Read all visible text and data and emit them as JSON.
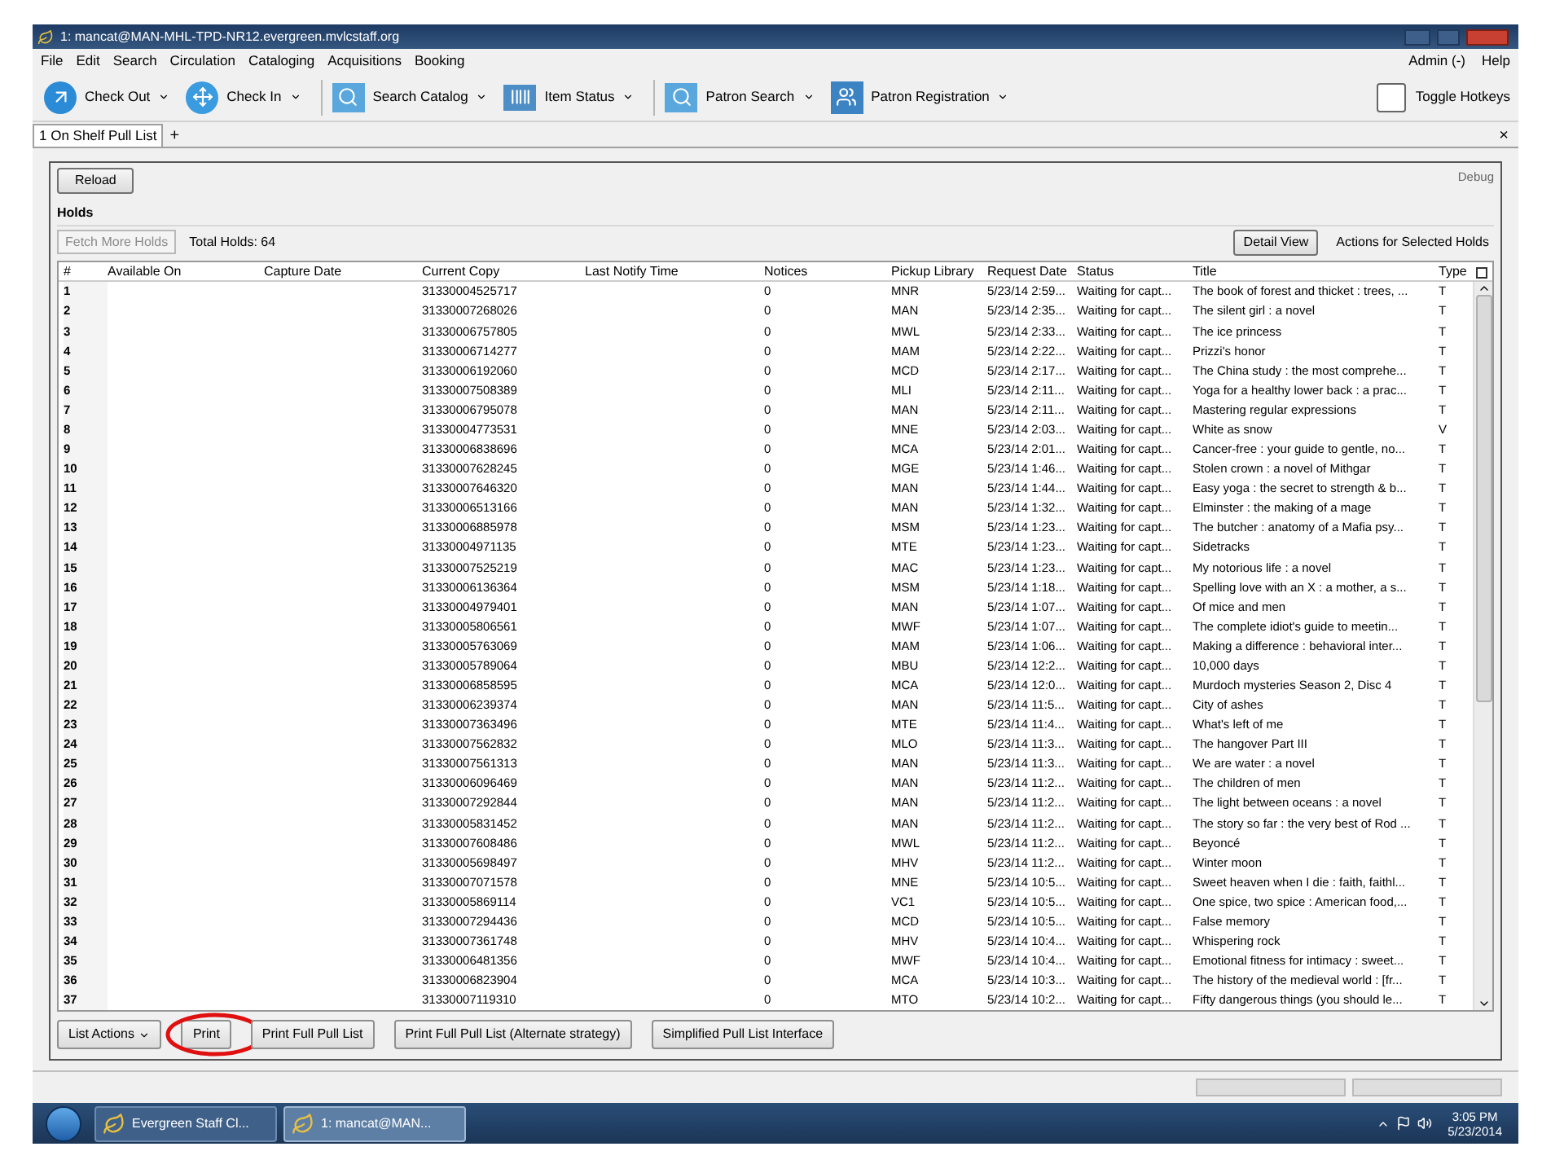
{
  "window": {
    "title": "1: mancat@MAN-MHL-TPD-NR12.evergreen.mvlcstaff.org"
  },
  "menu": [
    "File",
    "Edit",
    "Search",
    "Circulation",
    "Cataloging",
    "Acquisitions",
    "Booking"
  ],
  "menu_right": [
    "Admin (-)",
    "Help"
  ],
  "toolbar": [
    {
      "label": "Check Out",
      "kind": "checkout",
      "has_menu": true
    },
    {
      "label": "Check In",
      "kind": "checkin",
      "has_menu": true
    },
    {
      "label": "Search Catalog",
      "kind": "catalog",
      "has_menu": true
    },
    {
      "label": "Item Status",
      "kind": "item",
      "has_menu": true
    },
    {
      "label": "Patron Search",
      "kind": "patron",
      "has_menu": true
    },
    {
      "label": "Patron Registration",
      "kind": "register",
      "has_menu": true
    }
  ],
  "toggle_hotkeys": "Toggle Hotkeys",
  "tabs": [
    {
      "label": "1 On Shelf Pull List",
      "selected": true
    }
  ],
  "new_tab": "+",
  "close_tab": "×",
  "reload": "Reload",
  "debug": "Debug",
  "section": "Holds",
  "fetch_more": {
    "label": "Fetch More Holds",
    "disabled": true
  },
  "total": "Total Holds: 64",
  "detail_view": "Detail View",
  "actions_label": "Actions for Selected Holds",
  "columns": [
    "#",
    "Available On",
    "Capture Date",
    "Current Copy",
    "Last Notify Time",
    "Notices",
    "Pickup Library",
    "Request Date",
    "Status",
    "Title",
    "Type"
  ],
  "rows": [
    [
      "1",
      "31330004525717",
      "0",
      "MNR",
      "5/23/14 2:59...",
      "Waiting for capt...",
      "The book of forest and thicket : trees, ...",
      "T"
    ],
    [
      "2",
      "31330007268026",
      "0",
      "MAN",
      "5/23/14 2:35...",
      "Waiting for capt...",
      "The silent girl : a novel",
      "T"
    ],
    [
      "3",
      "31330006757805",
      "0",
      "MWL",
      "5/23/14 2:33...",
      "Waiting for capt...",
      "The ice princess",
      "T"
    ],
    [
      "4",
      "31330006714277",
      "0",
      "MAM",
      "5/23/14 2:22...",
      "Waiting for capt...",
      "Prizzi's honor",
      "T"
    ],
    [
      "5",
      "31330006192060",
      "0",
      "MCD",
      "5/23/14 2:17...",
      "Waiting for capt...",
      "The China study : the most comprehe...",
      "T"
    ],
    [
      "6",
      "31330007508389",
      "0",
      "MLI",
      "5/23/14 2:11...",
      "Waiting for capt...",
      "Yoga for a healthy lower back : a prac...",
      "T"
    ],
    [
      "7",
      "31330006795078",
      "0",
      "MAN",
      "5/23/14 2:11...",
      "Waiting for capt...",
      "Mastering regular expressions",
      "T"
    ],
    [
      "8",
      "31330004773531",
      "0",
      "MNE",
      "5/23/14 2:03...",
      "Waiting for capt...",
      "White as snow",
      "V"
    ],
    [
      "9",
      "31330006838696",
      "0",
      "MCA",
      "5/23/14 2:01...",
      "Waiting for capt...",
      "Cancer-free : your guide to gentle, no...",
      "T"
    ],
    [
      "10",
      "31330007628245",
      "0",
      "MGE",
      "5/23/14 1:46...",
      "Waiting for capt...",
      "Stolen crown : a novel of Mithgar",
      "T"
    ],
    [
      "11",
      "31330007646320",
      "0",
      "MAN",
      "5/23/14 1:44...",
      "Waiting for capt...",
      "Easy yoga : the secret to strength & b...",
      "T"
    ],
    [
      "12",
      "31330006513166",
      "0",
      "MAN",
      "5/23/14 1:32...",
      "Waiting for capt...",
      "Elminster : the making of a mage",
      "T"
    ],
    [
      "13",
      "31330006885978",
      "0",
      "MSM",
      "5/23/14 1:23...",
      "Waiting for capt...",
      "The butcher : anatomy of a Mafia psy...",
      "T"
    ],
    [
      "14",
      "31330004971135",
      "0",
      "MTE",
      "5/23/14 1:23...",
      "Waiting for capt...",
      "Sidetracks",
      "T"
    ],
    [
      "15",
      "31330007525219",
      "0",
      "MAC",
      "5/23/14 1:23...",
      "Waiting for capt...",
      "My notorious life : a novel",
      "T"
    ],
    [
      "16",
      "31330006136364",
      "0",
      "MSM",
      "5/23/14 1:18...",
      "Waiting for capt...",
      "Spelling love with an X : a mother, a s...",
      "T"
    ],
    [
      "17",
      "31330004979401",
      "0",
      "MAN",
      "5/23/14 1:07...",
      "Waiting for capt...",
      "Of mice and men",
      "T"
    ],
    [
      "18",
      "31330005806561",
      "0",
      "MWF",
      "5/23/14 1:07...",
      "Waiting for capt...",
      "The complete idiot's guide to meetin...",
      "T"
    ],
    [
      "19",
      "31330005763069",
      "0",
      "MAM",
      "5/23/14 1:06...",
      "Waiting for capt...",
      "Making a difference : behavioral inter...",
      "T"
    ],
    [
      "20",
      "31330005789064",
      "0",
      "MBU",
      "5/23/14 12:2...",
      "Waiting for capt...",
      "10,000 days",
      "T"
    ],
    [
      "21",
      "31330006858595",
      "0",
      "MCA",
      "5/23/14 12:0...",
      "Waiting for capt...",
      "Murdoch mysteries Season 2, Disc 4",
      "T"
    ],
    [
      "22",
      "31330006239374",
      "0",
      "MAN",
      "5/23/14 11:5...",
      "Waiting for capt...",
      "City of ashes",
      "T"
    ],
    [
      "23",
      "31330007363496",
      "0",
      "MTE",
      "5/23/14 11:4...",
      "Waiting for capt...",
      "What's left of me",
      "T"
    ],
    [
      "24",
      "31330007562832",
      "0",
      "MLO",
      "5/23/14 11:3...",
      "Waiting for capt...",
      "The hangover Part III",
      "T"
    ],
    [
      "25",
      "31330007561313",
      "0",
      "MAN",
      "5/23/14 11:3...",
      "Waiting for capt...",
      "We are water : a novel",
      "T"
    ],
    [
      "26",
      "31330006096469",
      "0",
      "MAN",
      "5/23/14 11:2...",
      "Waiting for capt...",
      "The children of men",
      "T"
    ],
    [
      "27",
      "31330007292844",
      "0",
      "MAN",
      "5/23/14 11:2...",
      "Waiting for capt...",
      "The light between oceans : a novel",
      "T"
    ],
    [
      "28",
      "31330005831452",
      "0",
      "MAN",
      "5/23/14 11:2...",
      "Waiting for capt...",
      "The story so far : the very best of Rod ...",
      "T"
    ],
    [
      "29",
      "31330007608486",
      "0",
      "MWL",
      "5/23/14 11:2...",
      "Waiting for capt...",
      "Beyoncé",
      "T"
    ],
    [
      "30",
      "31330005698497",
      "0",
      "MHV",
      "5/23/14 11:2...",
      "Waiting for capt...",
      "Winter moon",
      "T"
    ],
    [
      "31",
      "31330007071578",
      "0",
      "MNE",
      "5/23/14 10:5...",
      "Waiting for capt...",
      "Sweet heaven when I die : faith, faithl...",
      "T"
    ],
    [
      "32",
      "31330005869114",
      "0",
      "VC1",
      "5/23/14 10:5...",
      "Waiting for capt...",
      "One spice, two spice : American food,...",
      "T"
    ],
    [
      "33",
      "31330007294436",
      "0",
      "MCD",
      "5/23/14 10:5...",
      "Waiting for capt...",
      "False memory",
      "T"
    ],
    [
      "34",
      "31330007361748",
      "0",
      "MHV",
      "5/23/14 10:4...",
      "Waiting for capt...",
      "Whispering rock",
      "T"
    ],
    [
      "35",
      "31330006481356",
      "0",
      "MWF",
      "5/23/14 10:4...",
      "Waiting for capt...",
      "Emotional fitness for intimacy : sweet...",
      "T"
    ],
    [
      "36",
      "31330006823904",
      "0",
      "MCA",
      "5/23/14 10:3...",
      "Waiting for capt...",
      "The history of the medieval world : [fr...",
      "T"
    ],
    [
      "37",
      "31330007119310",
      "0",
      "MTO",
      "5/23/14 10:2...",
      "Waiting for capt...",
      "Fifty dangerous things (you should le...",
      "T"
    ]
  ],
  "bottom_buttons": [
    {
      "label": "List Actions",
      "has_menu": true,
      "highlighted": false
    },
    {
      "label": "Print",
      "has_menu": false,
      "highlighted": true
    },
    {
      "label": "Print Full Pull List",
      "has_menu": false,
      "highlighted": false
    },
    {
      "label": "Print Full Pull List (Alternate strategy)",
      "has_menu": false,
      "highlighted": false
    },
    {
      "label": "Simplified Pull List Interface",
      "has_menu": false,
      "highlighted": false
    }
  ],
  "taskbar": [
    {
      "label": "Evergreen Staff Cl...",
      "selected": false
    },
    {
      "label": "1: mancat@MAN...",
      "selected": true
    }
  ],
  "clock": {
    "time": "3:05 PM",
    "date": "5/23/2014"
  }
}
